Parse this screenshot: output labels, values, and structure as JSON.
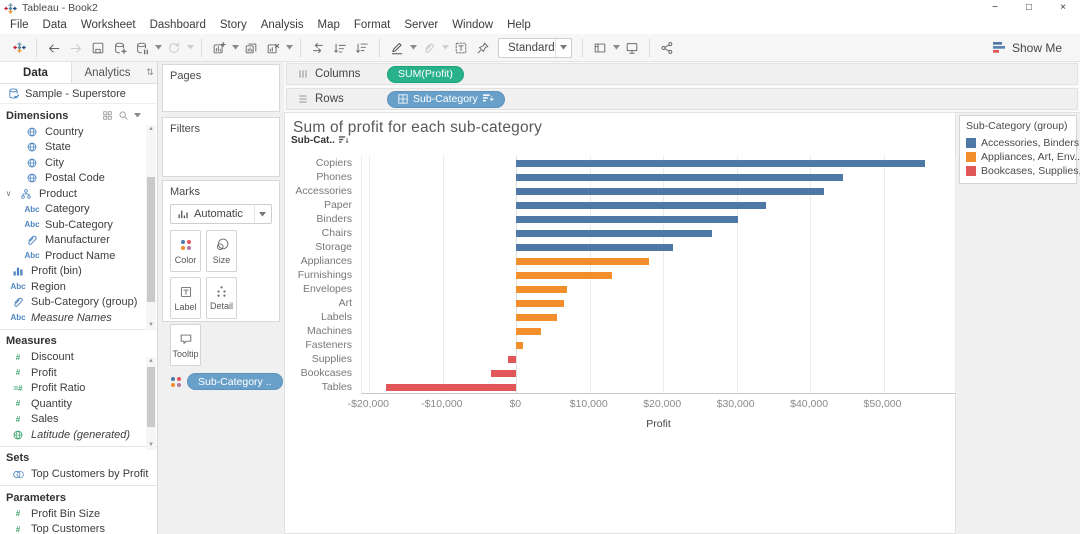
{
  "window": {
    "title": "Tableau - Book2",
    "minimize": "−",
    "maximize": "□",
    "close": "×"
  },
  "menu": {
    "items": [
      "File",
      "Data",
      "Worksheet",
      "Dashboard",
      "Story",
      "Analysis",
      "Map",
      "Format",
      "Server",
      "Window",
      "Help"
    ]
  },
  "toolbar": {
    "view_mode": "Standard",
    "show_me_label": "Show Me"
  },
  "data_pane": {
    "tabs": [
      {
        "label": "Data"
      },
      {
        "label": "Analytics"
      }
    ],
    "datasource": "Sample - Superstore",
    "sections": [
      {
        "title": "Dimensions",
        "header_icons": true,
        "items": [
          {
            "icon": "globe",
            "label": "Country",
            "indent": 1
          },
          {
            "icon": "globe",
            "label": "State",
            "indent": 1
          },
          {
            "icon": "globe",
            "label": "City",
            "indent": 1
          },
          {
            "icon": "globe",
            "label": "Postal Code",
            "indent": 1
          },
          {
            "icon": "tree",
            "label": "Product",
            "indent": 0,
            "caret": true
          },
          {
            "icon": "abc",
            "label": "Category",
            "indent": 1
          },
          {
            "icon": "abc",
            "label": "Sub-Category",
            "indent": 1
          },
          {
            "icon": "clip",
            "label": "Manufacturer",
            "indent": 1
          },
          {
            "icon": "abc",
            "label": "Product Name",
            "indent": 1
          },
          {
            "icon": "binhist",
            "label": "Profit (bin)",
            "indent": 0
          },
          {
            "icon": "abc",
            "label": "Region",
            "indent": 0
          },
          {
            "icon": "clip",
            "label": "Sub-Category (group)",
            "indent": 0
          },
          {
            "icon": "abc",
            "label": "Measure Names",
            "indent": 0,
            "italic": true
          }
        ]
      },
      {
        "title": "Measures",
        "items": [
          {
            "icon": "hash",
            "label": "Discount",
            "indent": 0
          },
          {
            "icon": "hash",
            "label": "Profit",
            "indent": 0
          },
          {
            "icon": "hashcalc",
            "label": "Profit Ratio",
            "indent": 0
          },
          {
            "icon": "hash",
            "label": "Quantity",
            "indent": 0
          },
          {
            "icon": "hash",
            "label": "Sales",
            "indent": 0
          },
          {
            "icon": "globe-g",
            "label": "Latitude (generated)",
            "indent": 0,
            "italic": true
          }
        ]
      },
      {
        "title": "Sets",
        "items": [
          {
            "icon": "venn",
            "label": "Top Customers by Profit",
            "indent": 0
          }
        ]
      },
      {
        "title": "Parameters",
        "items": [
          {
            "icon": "hash",
            "label": "Profit Bin Size",
            "indent": 0
          },
          {
            "icon": "hash",
            "label": "Top Customers",
            "indent": 0
          }
        ]
      }
    ]
  },
  "cards": {
    "pages_label": "Pages",
    "filters_label": "Filters",
    "marks": {
      "label": "Marks",
      "mark_type": "Automatic",
      "buttons": [
        {
          "icon": "color-dots",
          "label": "Color"
        },
        {
          "icon": "size",
          "label": "Size"
        },
        {
          "icon": "labelbtn",
          "label": "Label"
        },
        {
          "icon": "detail",
          "label": "Detail"
        },
        {
          "icon": "tooltip",
          "label": "Tooltip"
        }
      ],
      "pill": "Sub-Category .."
    }
  },
  "shelves": {
    "columns_label": "Columns",
    "columns_pill": "SUM(Profit)",
    "rows_label": "Rows",
    "rows_pill": "Sub-Category"
  },
  "sheet": {
    "title": "Sum of profit for each sub-category",
    "row_header": "Sub-Cat.."
  },
  "legend": {
    "title": "Sub-Category (group)",
    "entries": [
      {
        "color": "#4e79a7",
        "label": "Accessories, Binders.."
      },
      {
        "color": "#f28e2b",
        "label": "Appliances, Art, Env.."
      },
      {
        "color": "#e15759",
        "label": "Bookcases, Supplies,.."
      }
    ]
  },
  "chart_data": {
    "type": "bar",
    "orientation": "horizontal",
    "title": "Sum of profit for each sub-category",
    "categories": [
      "Copiers",
      "Phones",
      "Accessories",
      "Paper",
      "Binders",
      "Chairs",
      "Storage",
      "Appliances",
      "Furnishings",
      "Envelopes",
      "Art",
      "Labels",
      "Machines",
      "Fasteners",
      "Supplies",
      "Bookcases",
      "Tables"
    ],
    "values": [
      55618,
      44516,
      41937,
      34054,
      30222,
      26590,
      21279,
      18138,
      13059,
      6964,
      6528,
      5546,
      3385,
      950,
      -1189,
      -3473,
      -17725
    ],
    "bar_colors": [
      "#4e79a7",
      "#4e79a7",
      "#4e79a7",
      "#4e79a7",
      "#4e79a7",
      "#4e79a7",
      "#4e79a7",
      "#f28e2b",
      "#f28e2b",
      "#f28e2b",
      "#f28e2b",
      "#f28e2b",
      "#f28e2b",
      "#f28e2b",
      "#e15759",
      "#e15759",
      "#e15759"
    ],
    "xlabel": "Profit",
    "ylabel": "Sub-Cat..",
    "x_ticks": [
      "-$20,000",
      "-$10,000",
      "$0",
      "$10,000",
      "$20,000",
      "$30,000",
      "$40,000",
      "$50,000"
    ],
    "x_tick_values": [
      -20000,
      -10000,
      0,
      10000,
      20000,
      30000,
      40000,
      50000
    ],
    "xlim": [
      -21000,
      60000
    ],
    "grid": true,
    "legend_position": "right"
  }
}
